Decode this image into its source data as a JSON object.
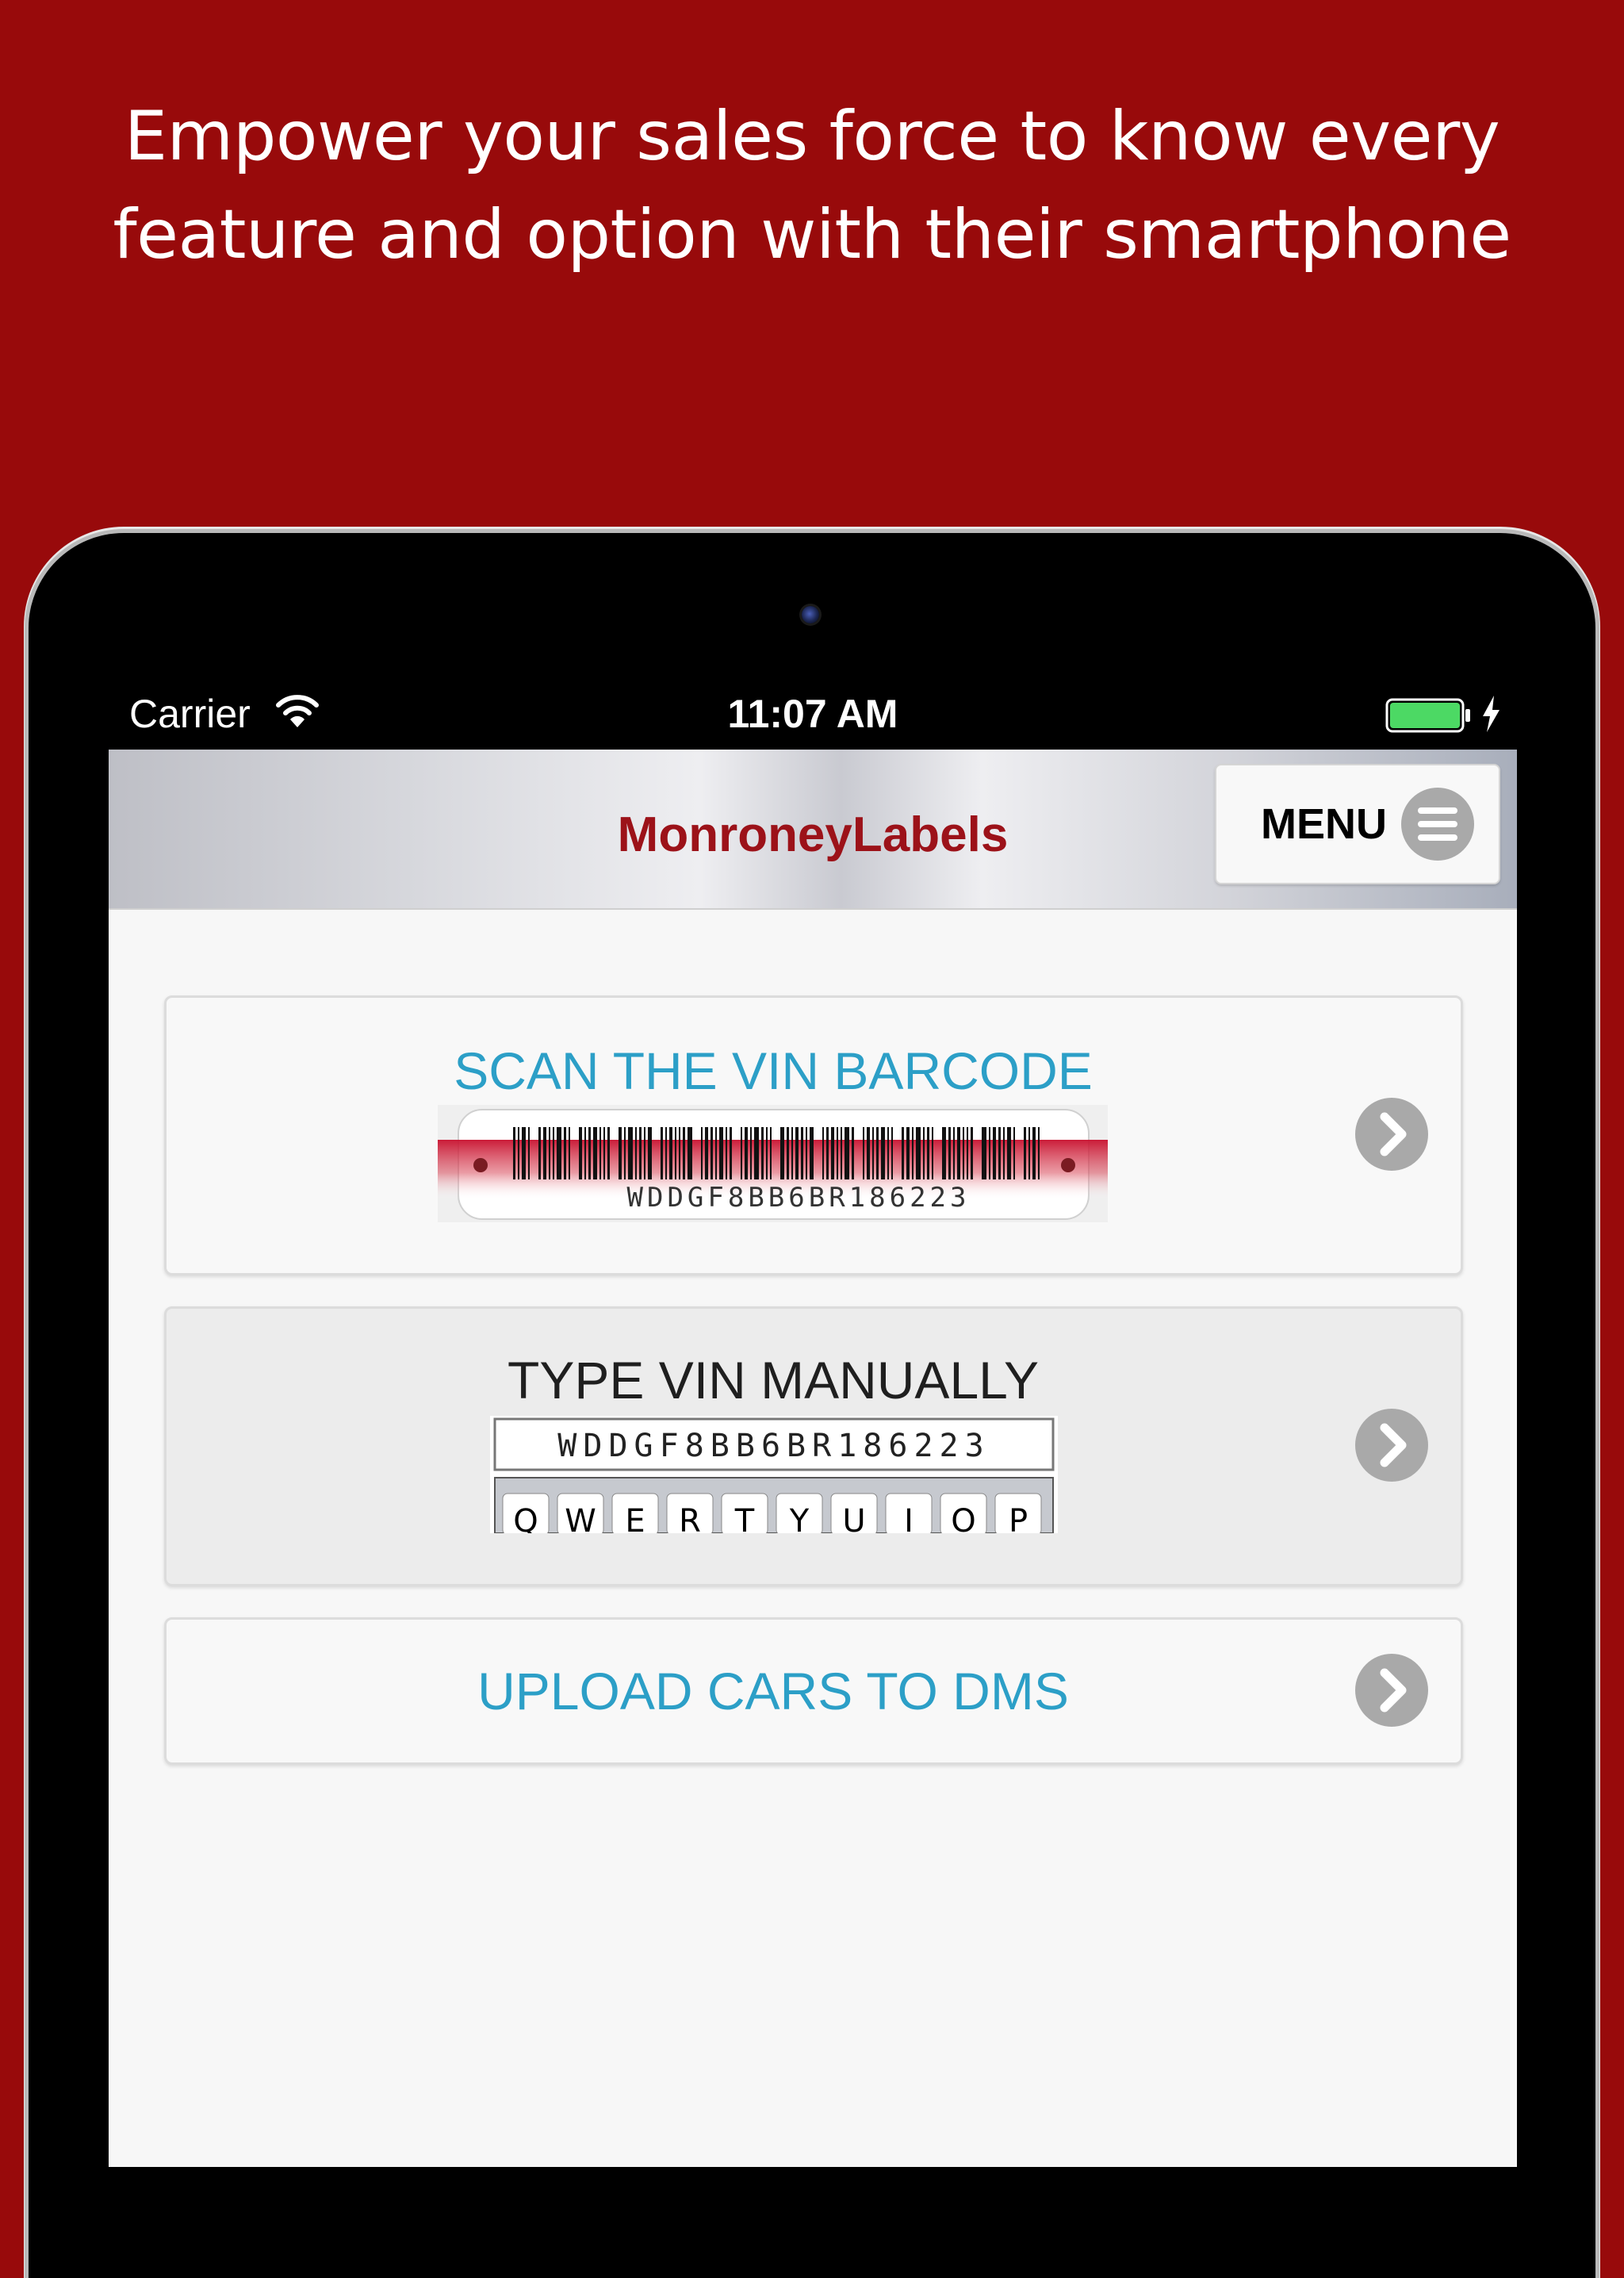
{
  "headline": {
    "line1": "Empower your sales force to know every",
    "line2": "feature and option with their smartphone"
  },
  "statusbar": {
    "carrier": "Carrier",
    "time": "11:07 AM",
    "battery_color": "#4cd964"
  },
  "navbar": {
    "title": "MonroneyLabels",
    "menu_label": "MENU"
  },
  "cards": {
    "scan": {
      "title": "SCAN THE VIN BARCODE",
      "vin": "WDDGF8BB6BR186223"
    },
    "manual": {
      "title": "TYPE VIN MANUALLY",
      "vin": "WDDGF8BB6BR186223",
      "keys": [
        "Q",
        "W",
        "E",
        "R",
        "T",
        "Y",
        "U",
        "I",
        "O",
        "P"
      ]
    },
    "upload": {
      "title": "UPLOAD CARS TO DMS"
    }
  },
  "colors": {
    "background": "#980a0b",
    "brand_red": "#9c1219",
    "link_blue": "#2c9fc7"
  }
}
